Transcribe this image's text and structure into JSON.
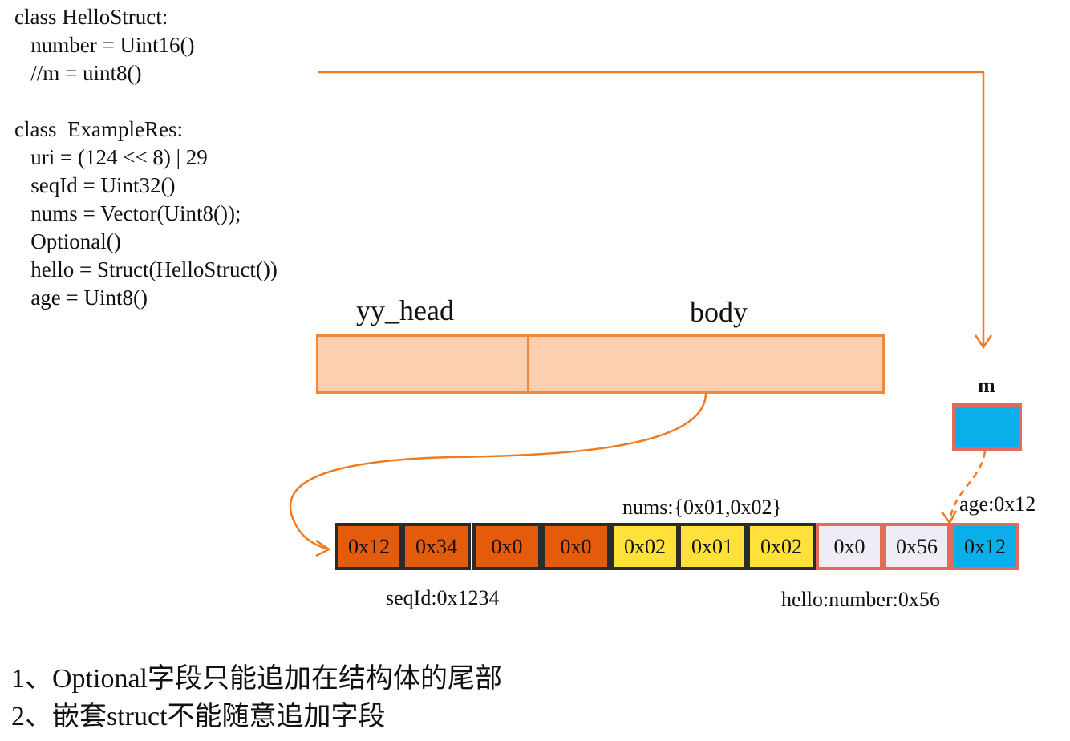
{
  "code": {
    "lines": [
      "class HelloStruct:",
      "   number = Uint16()",
      "   //m = uint8()",
      "",
      "class  ExampleRes:",
      "   uri = (124 << 8) | 29",
      "   seqId = Uint32()",
      "   nums = Vector(Uint8());",
      "   Optional()",
      "   hello = Struct(HelloStruct())",
      "   age = Uint8()"
    ]
  },
  "packet": {
    "head_label": "yy_head",
    "body_label": "body"
  },
  "new_field": {
    "label": "m"
  },
  "bytes": [
    {
      "text": "0x12",
      "fill": "#e55b0c",
      "border": "#2b2b2b"
    },
    {
      "text": "0x34",
      "fill": "#e55b0c",
      "border": "#2b2b2b"
    },
    {
      "text": "0x0",
      "fill": "#e55b0c",
      "border": "#2b2b2b"
    },
    {
      "text": "0x0",
      "fill": "#e55b0c",
      "border": "#2b2b2b"
    },
    {
      "text": "0x02",
      "fill": "#ffe13a",
      "border": "#2b2b2b"
    },
    {
      "text": "0x01",
      "fill": "#ffe13a",
      "border": "#2b2b2b"
    },
    {
      "text": "0x02",
      "fill": "#ffe13a",
      "border": "#2b2b2b"
    },
    {
      "text": "0x0",
      "fill": "#eeedf6",
      "border": "#e26b5a"
    },
    {
      "text": "0x56",
      "fill": "#eeedf6",
      "border": "#e26b5a"
    },
    {
      "text": "0x12",
      "fill": "#0aaee8",
      "border": "#e26b5a"
    }
  ],
  "annotations": {
    "nums": "nums:{0x01,0x02}",
    "age": "age:0x12",
    "seqId": "seqId:0x1234",
    "hello": "hello:number:0x56"
  },
  "notes": [
    "1、Optional字段只能追加在结构体的尾部",
    "2、嵌套struct不能随意追加字段"
  ],
  "colors": {
    "arrow": "#f07a22",
    "bar_fill": "#fdcfb1",
    "bar_border": "#f08a38",
    "m_fill": "#0aaee8",
    "m_border": "#e26b5a"
  }
}
